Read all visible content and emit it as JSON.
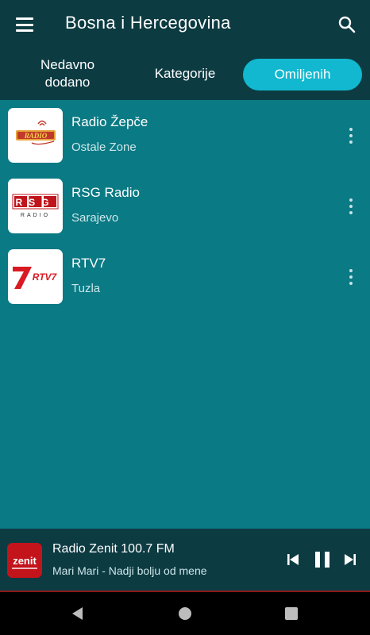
{
  "appbar": {
    "title": "Bosna i Hercegovina",
    "menu_icon": "hamburger-menu-icon",
    "search_icon": "search-icon"
  },
  "tabs": [
    {
      "label_line1": "Nedavno",
      "label_line2": "dodano",
      "active": false
    },
    {
      "label": "Kategorije",
      "active": false
    },
    {
      "label": "Omiljenih",
      "active": true
    }
  ],
  "stations": [
    {
      "name": "Radio Žepče",
      "subtitle": "Ostale Zone",
      "logo_icon": "radio-zepce-logo",
      "more_icon": "more-vert-icon"
    },
    {
      "name": "RSG Radio",
      "subtitle": "Sarajevo",
      "logo_icon": "rsg-radio-logo",
      "logo_text": "RSG",
      "logo_subtext": "RADIO",
      "more_icon": "more-vert-icon"
    },
    {
      "name": "RTV7",
      "subtitle": "Tuzla",
      "logo_icon": "rtv7-logo",
      "logo_text": "RTV7",
      "more_icon": "more-vert-icon"
    }
  ],
  "player": {
    "station": "Radio Zenit 100.7 FM",
    "track": "Mari Mari - Nadji bolju od mene",
    "art_icon": "radio-zenit-logo",
    "art_text": "zenit",
    "controls": [
      "skip-previous-icon",
      "pause-icon",
      "skip-next-icon"
    ]
  },
  "system_nav": [
    "back-icon",
    "home-icon",
    "recents-icon"
  ],
  "colors": {
    "appbar": "#0d3b42",
    "background": "#0a7a84",
    "active_tab": "#11b8d0",
    "text": "#ffffff"
  }
}
